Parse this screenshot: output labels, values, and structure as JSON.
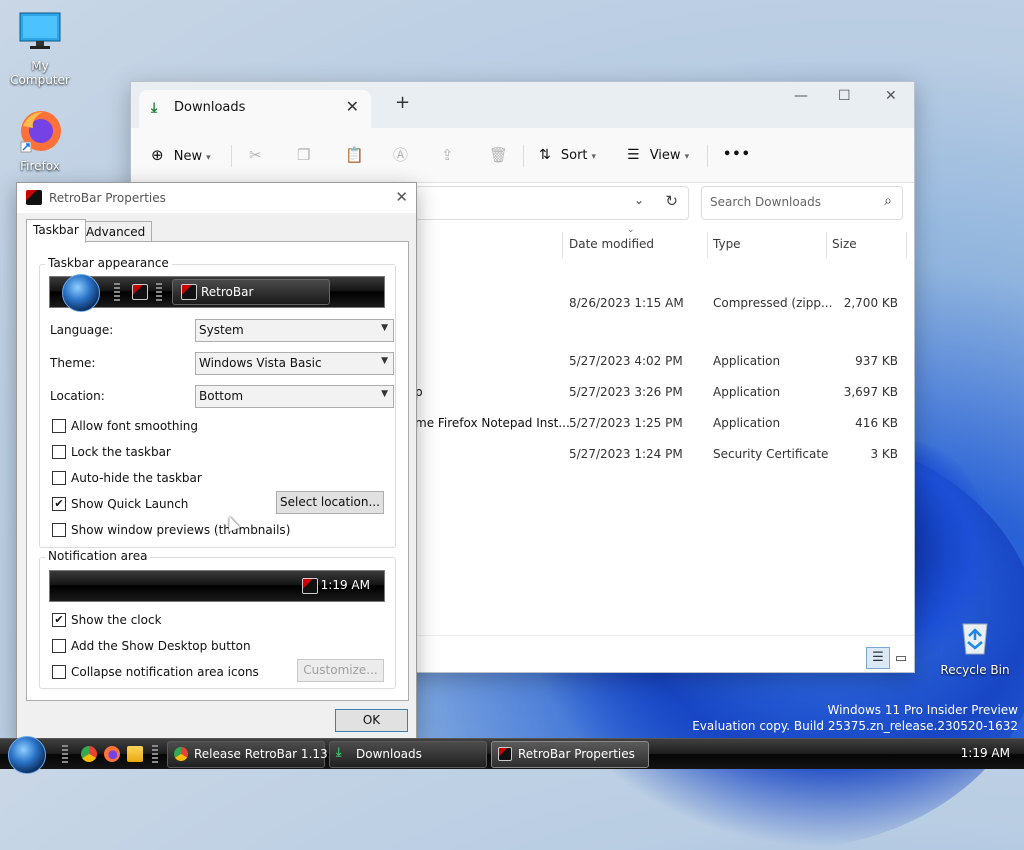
{
  "desktop": {
    "icons": [
      {
        "label": "My Computer"
      },
      {
        "label": "Firefox"
      },
      {
        "label": "Recycle Bin"
      }
    ],
    "watermark": {
      "line1": "Windows 11 Pro Insider Preview",
      "line2": "Evaluation copy. Build 25375.zn_release.230520-1632"
    }
  },
  "explorer": {
    "tab_title": "Downloads",
    "toolbar": {
      "new_label": "New",
      "sort_label": "Sort",
      "view_label": "View",
      "more_label": "•••"
    },
    "search_placeholder": "Search Downloads",
    "columns": {
      "date": "Date modified",
      "type": "Type",
      "size": "Size"
    },
    "files": [
      {
        "name": "",
        "date": "8/26/2023 1:15 AM",
        "type": "Compressed (zipp...",
        "size": "2,700 KB"
      },
      {
        "name": "",
        "date": "5/27/2023 4:02 PM",
        "type": "Application",
        "size": "937 KB"
      },
      {
        "name": "p",
        "date": "5/27/2023 3:26 PM",
        "type": "Application",
        "size": "3,697 KB"
      },
      {
        "name": "me Firefox Notepad Inst...",
        "date": "5/27/2023 1:25 PM",
        "type": "Application",
        "size": "416 KB"
      },
      {
        "name": "",
        "date": "5/27/2023 1:24 PM",
        "type": "Security Certificate",
        "size": "3 KB"
      }
    ]
  },
  "dialog": {
    "title": "RetroBar Properties",
    "tabs": [
      "Taskbar",
      "Advanced"
    ],
    "appearance": {
      "group_title": "Taskbar appearance",
      "preview_button_label": "RetroBar",
      "language_label": "Language:",
      "language_value": "System",
      "theme_label": "Theme:",
      "theme_value": "Windows Vista Basic",
      "location_label": "Location:",
      "location_value": "Bottom",
      "options": [
        {
          "label": "Allow font smoothing",
          "checked": false
        },
        {
          "label": "Lock the taskbar",
          "checked": false
        },
        {
          "label": "Auto-hide the taskbar",
          "checked": false
        },
        {
          "label": "Show Quick Launch",
          "checked": true
        },
        {
          "label": "Show window previews (thumbnails)",
          "checked": false
        }
      ],
      "select_location_label": "Select location..."
    },
    "notification": {
      "group_title": "Notification area",
      "preview_clock": "1:19 AM",
      "options": [
        {
          "label": "Show the clock",
          "checked": true
        },
        {
          "label": "Add the Show Desktop button",
          "checked": false
        },
        {
          "label": "Collapse notification area icons",
          "checked": false
        }
      ],
      "customize_label": "Customize..."
    },
    "ok_label": "OK"
  },
  "taskbar": {
    "tasks": [
      {
        "label": "Release RetroBar 1.13..."
      },
      {
        "label": "Downloads"
      },
      {
        "label": "RetroBar Properties"
      }
    ],
    "clock": "1:19 AM"
  },
  "colors": {
    "accent": "#0067c0",
    "taskbar": "#111111",
    "wallpaper_blue": "#1d4fd8"
  }
}
